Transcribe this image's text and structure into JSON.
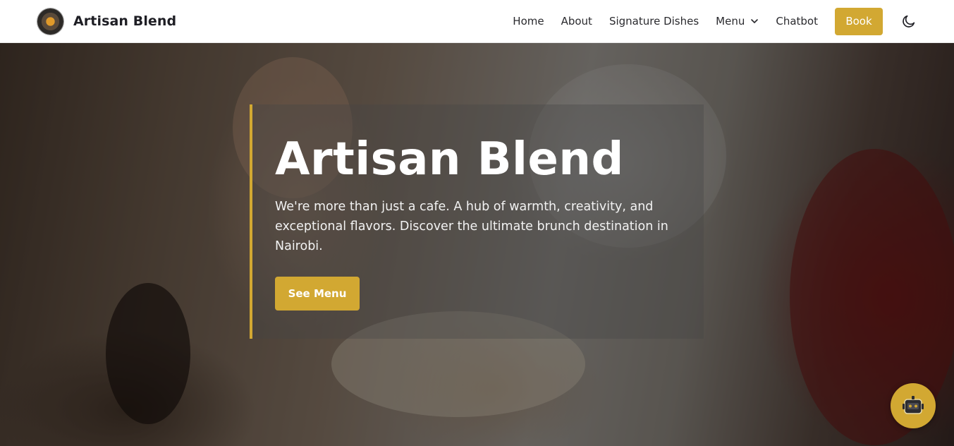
{
  "brand": {
    "name": "Artisan Blend",
    "logo_icon": "logo-bowl-icon"
  },
  "nav": {
    "links": [
      "Home",
      "About",
      "Signature Dishes",
      "Menu",
      "Chatbot"
    ],
    "menu_dropdown_icon": "chevron-down-icon",
    "book_label": "Book",
    "theme_toggle_icon": "moon-icon"
  },
  "hero": {
    "title": "Artisan Blend",
    "description": "We're more than just a cafe. A hub of warmth, creativity, and exceptional flavors. Discover the ultimate brunch destination in Nairobi.",
    "cta_label": "See Menu",
    "background": "restaurant-diners-photo"
  },
  "chatbot_fab": {
    "icon": "robot-icon"
  },
  "colors": {
    "accent": "#d2a832",
    "nav_bg": "#ffffff",
    "nav_text": "#2a2a2e",
    "hero_text": "#ffffff"
  }
}
